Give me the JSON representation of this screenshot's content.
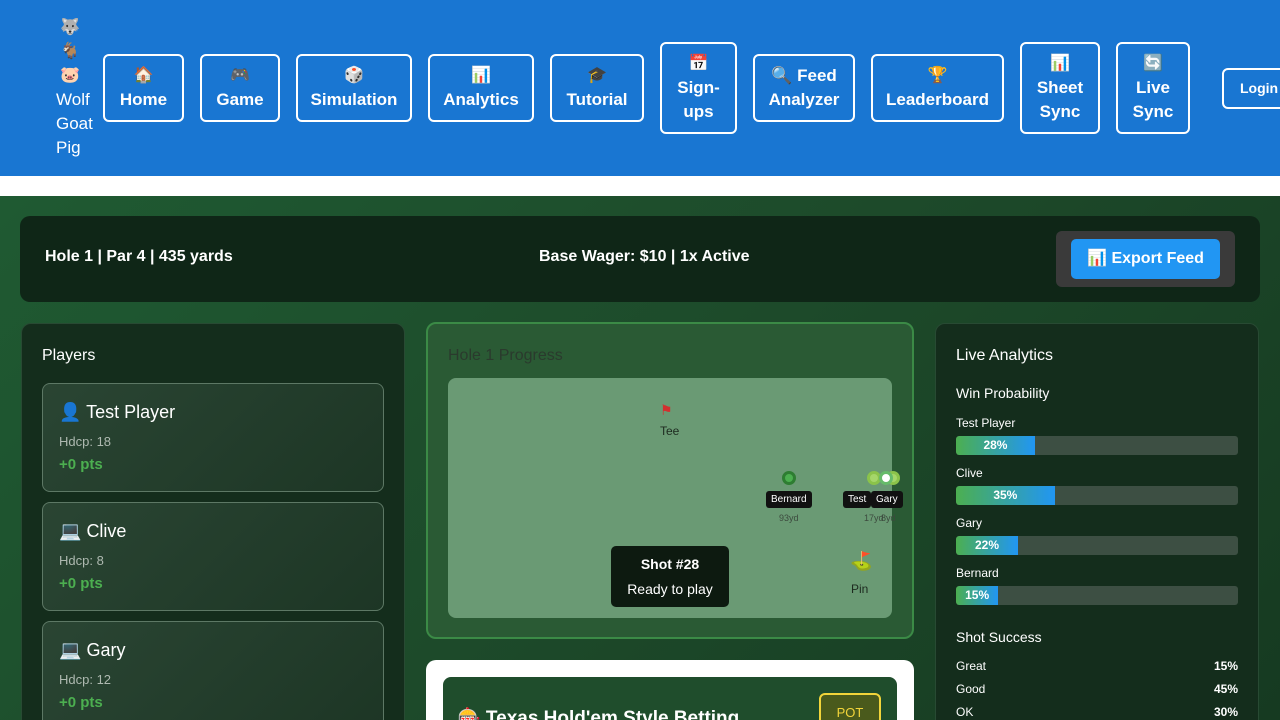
{
  "brand": {
    "emojis": [
      "🐺",
      "🐐",
      "🐷"
    ],
    "words": [
      "Wolf",
      "Goat",
      "Pig"
    ]
  },
  "nav": [
    {
      "icon": "🏠",
      "label": "Home"
    },
    {
      "icon": "🎮",
      "label": "Game"
    },
    {
      "icon": "🎲",
      "label": "Simulation"
    },
    {
      "icon": "📊",
      "label": "Analytics"
    },
    {
      "icon": "🎓",
      "label": "Tutorial"
    },
    {
      "icon": "📅",
      "label_lines": [
        "Sign-",
        "ups"
      ]
    },
    {
      "icon": "🔍",
      "label_lines": [
        "Feed",
        "Analyzer"
      ]
    },
    {
      "icon": "🏆",
      "label": "Leaderboard"
    },
    {
      "icon": "📊",
      "label_lines": [
        "Sheet",
        "Sync"
      ]
    },
    {
      "icon": "🔄",
      "label_lines": [
        "Live",
        "Sync"
      ]
    }
  ],
  "login_label": "Login",
  "hole": {
    "info": "Hole 1 | Par 4 | 435 yards",
    "wager": "Base Wager: $10 | 1x Active",
    "export_label": "📊 Export Feed"
  },
  "players_panel": {
    "title": "Players",
    "players": [
      {
        "icon": "👤",
        "name": "Test Player",
        "hdcp": "Hdcp: 18",
        "pts": "+0 pts"
      },
      {
        "icon": "💻",
        "name": "Clive",
        "hdcp": "Hdcp: 8",
        "pts": "+0 pts"
      },
      {
        "icon": "💻",
        "name": "Gary",
        "hdcp": "Hdcp: 12",
        "pts": "+0 pts"
      }
    ]
  },
  "progress": {
    "title": "Hole 1 Progress",
    "tee_label": "Tee",
    "pin_label": "Pin",
    "markers": [
      {
        "name": "Bernard",
        "distance": "93yd"
      },
      {
        "name": "Test",
        "distance": "17yd"
      },
      {
        "name": "Gary",
        "distance": "8yd"
      }
    ],
    "shot_number": "Shot #28",
    "shot_status": "Ready to play"
  },
  "betting": {
    "title": "🎰 Texas Hold'em Style Betting",
    "pot_label": "POT"
  },
  "analytics": {
    "title": "Live Analytics",
    "win_title": "Win Probability",
    "win_prob": [
      {
        "name": "Test Player",
        "pct": 28,
        "label": "28%"
      },
      {
        "name": "Clive",
        "pct": 35,
        "label": "35%"
      },
      {
        "name": "Gary",
        "pct": 22,
        "label": "22%"
      },
      {
        "name": "Bernard",
        "pct": 15,
        "label": "15%"
      }
    ],
    "shot_title": "Shot Success",
    "shot_success": [
      {
        "label": "Great",
        "value": "15%"
      },
      {
        "label": "Good",
        "value": "45%"
      },
      {
        "label": "OK",
        "value": "30%"
      }
    ]
  }
}
